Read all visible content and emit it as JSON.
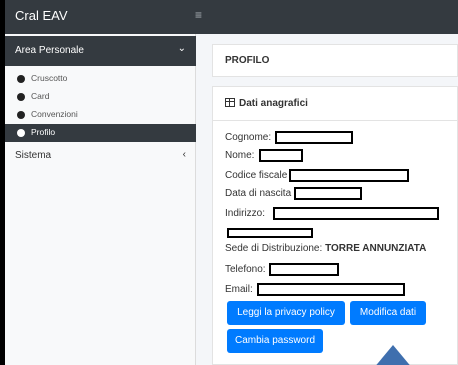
{
  "app": {
    "title": "Cral EAV",
    "menu_icon": "≡"
  },
  "sidebar": {
    "section_label": "Area Personale",
    "section_chevron": "⌄",
    "items": [
      {
        "label": "Cruscotto"
      },
      {
        "label": "Card"
      },
      {
        "label": "Convenzioni"
      },
      {
        "label": "Profilo"
      }
    ],
    "sistema_label": "Sistema",
    "sistema_chevron": "‹"
  },
  "main": {
    "page_title": "PROFILO",
    "card_title": "Dati anagrafici",
    "fields": {
      "cognome": "Cognome:",
      "nome": "Nome:",
      "codice_fiscale": "Codice fiscale",
      "data_nascita": "Data di nascita",
      "indirizzo": "Indirizzo:",
      "sede_label": "Sede di Distribuzione:",
      "sede_value": "TORRE ANNUNZIATA",
      "telefono": "Telefono:",
      "email": "Email:"
    },
    "buttons": {
      "privacy": "Leggi la privacy policy",
      "modifica": "Modifica dati",
      "password": "Cambia password"
    }
  },
  "colors": {
    "topbar": "#343a40",
    "primary_button": "#007bff",
    "arrow": "#3f6fae"
  }
}
